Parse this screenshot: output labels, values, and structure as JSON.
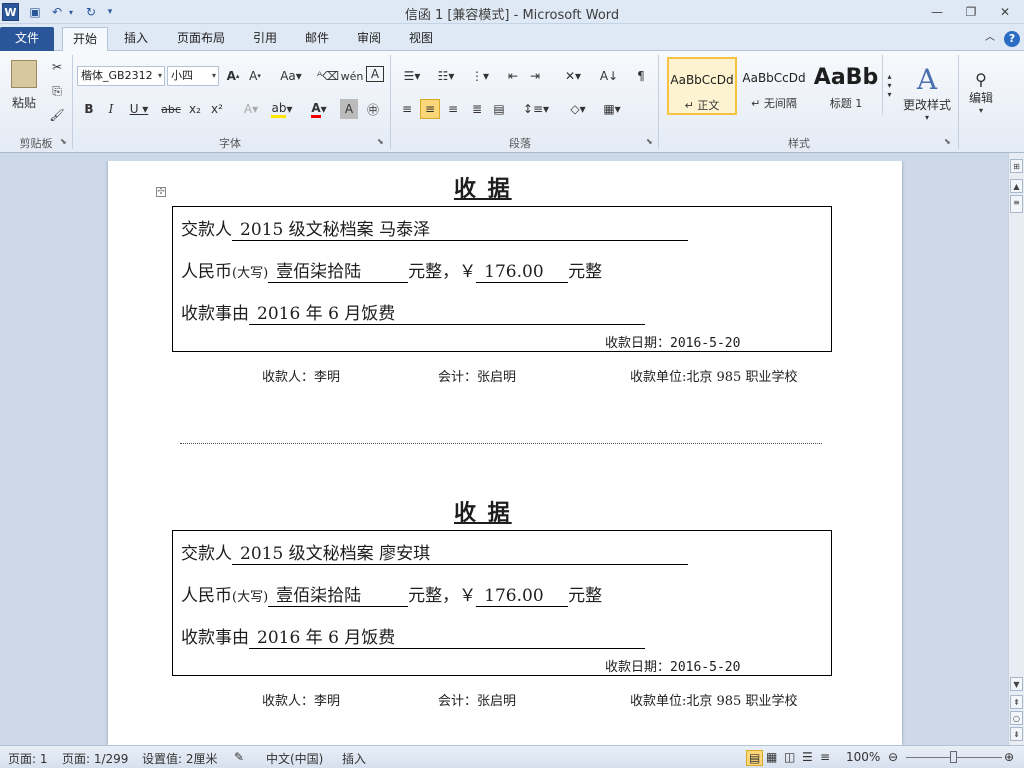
{
  "titlebar": {
    "title": "信函 1 [兼容模式] - Microsoft Word",
    "logo": "W"
  },
  "tabs": [
    "文件",
    "开始",
    "插入",
    "页面布局",
    "引用",
    "邮件",
    "审阅",
    "视图"
  ],
  "ribbon": {
    "clipboard": {
      "paste": "粘贴",
      "group": "剪贴板"
    },
    "font": {
      "name": "楷体_GB2312",
      "size": "小四",
      "group": "字体"
    },
    "paragraph": {
      "group": "段落"
    },
    "styles": {
      "group": "样式",
      "items": [
        {
          "preview": "AaBbCcDd",
          "name": "↵ 正文"
        },
        {
          "preview": "AaBbCcDd",
          "name": "↵ 无间隔"
        },
        {
          "preview": "AaBb",
          "name": "标题 1"
        }
      ],
      "change": "更改样式"
    },
    "editing": {
      "label": "编辑"
    }
  },
  "document": {
    "receipts": [
      {
        "title": "收    据",
        "payer_label": "交款人",
        "payer": "2015 级文秘档案  马泰泽",
        "amount_label": "人民币",
        "amount_note": "(大写)",
        "amount_text": "壹佰柒拾陆",
        "amount_suffix": "元整，￥",
        "amount_num": "176.00",
        "amount_end": "元整",
        "reason_label": "收款事由",
        "reason": "2016 年 6 月饭费",
        "date": "收款日期：2016-5-20",
        "receiver": "收款人：李明",
        "accountant": "会计：张启明",
        "unit": "收款单位:北京 985 职业学校"
      },
      {
        "title": "收    据",
        "payer_label": "交款人",
        "payer": "2015 级文秘档案  廖安琪",
        "amount_label": "人民币",
        "amount_note": "(大写)",
        "amount_text": "壹佰柒拾陆",
        "amount_suffix": "元整，￥",
        "amount_num": "176.00",
        "amount_end": "元整",
        "reason_label": "收款事由",
        "reason": "2016 年 6 月饭费",
        "date": "收款日期：2016-5-20",
        "receiver": "收款人：李明",
        "accountant": "会计：张启明",
        "unit": "收款单位:北京 985 职业学校"
      }
    ]
  },
  "status": {
    "page": "页面: 1",
    "pages": "页面: 1/299",
    "setting": "设置值: 2厘米",
    "lang": "中文(中国)",
    "mode": "插入",
    "zoom": "100%"
  }
}
